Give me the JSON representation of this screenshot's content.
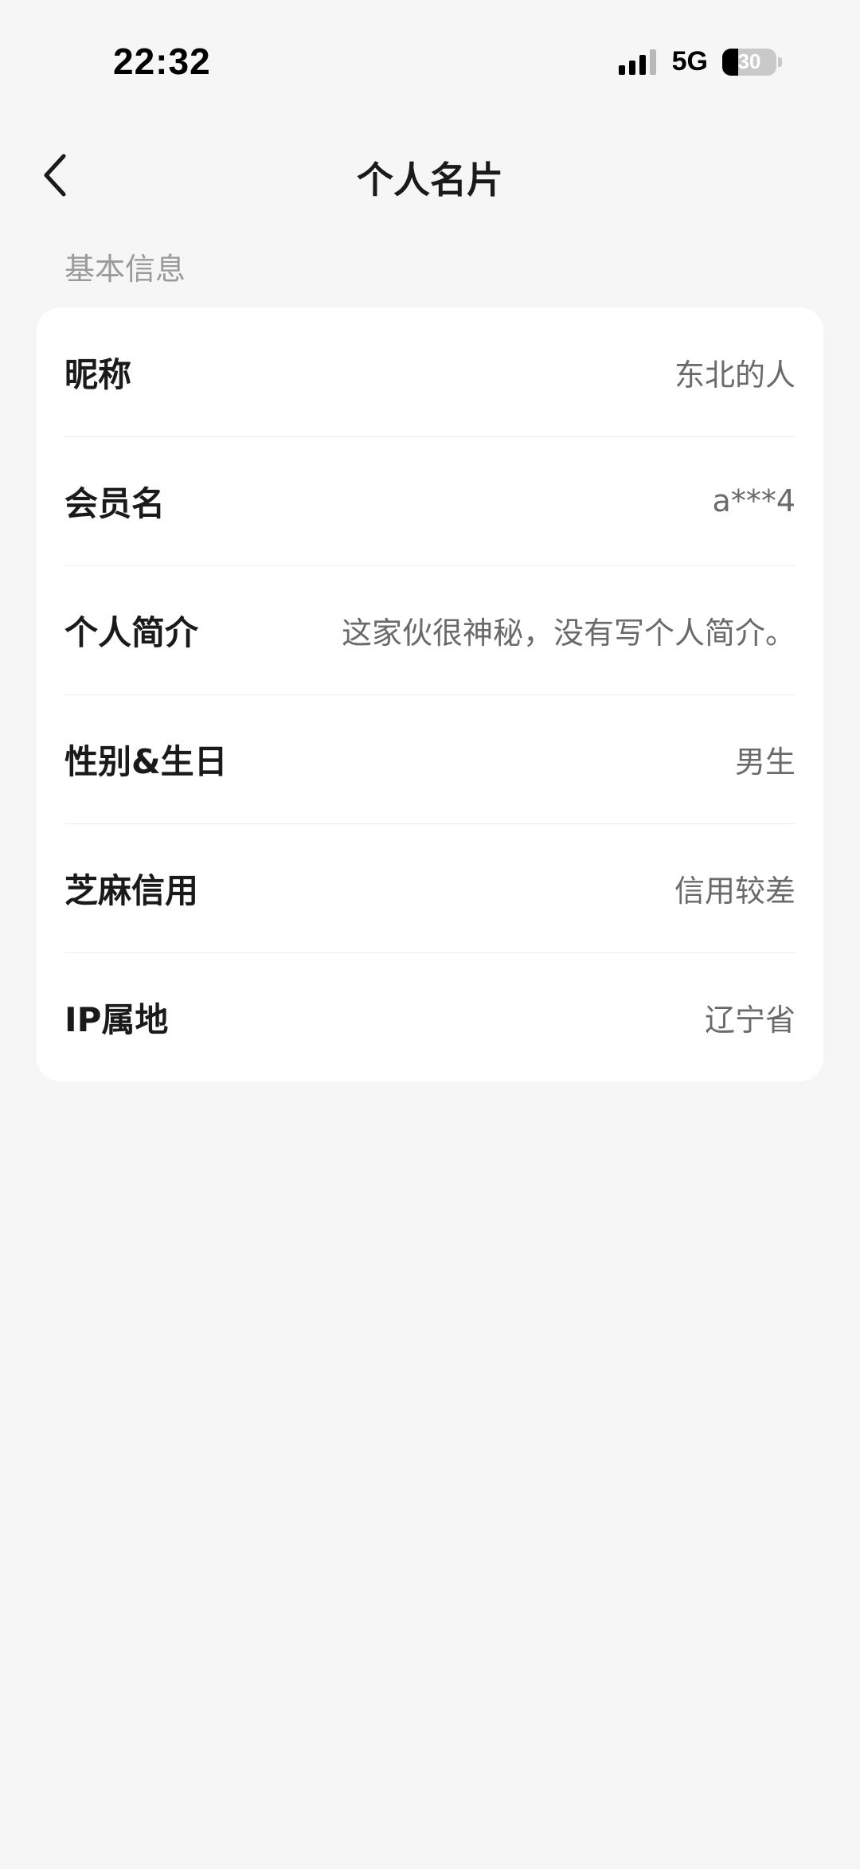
{
  "status_bar": {
    "time": "22:32",
    "network": "5G",
    "battery": "30",
    "battery_level": 0.3
  },
  "nav": {
    "title": "个人名片",
    "back_icon": "chevron-left-icon"
  },
  "section": {
    "title": "基本信息"
  },
  "rows": [
    {
      "label": "昵称",
      "value": "东北的人"
    },
    {
      "label": "会员名",
      "value": "a***4"
    },
    {
      "label": "个人简介",
      "value": "这家伙很神秘，没有写个人简介。"
    },
    {
      "label": "性别&生日",
      "value": "男生"
    },
    {
      "label": "芝麻信用",
      "value": "信用较差"
    },
    {
      "label": "IP属地",
      "value": "辽宁省"
    }
  ],
  "colors": {
    "background": "#f6f6f6",
    "card": "#ffffff",
    "label": "#1a1a1a",
    "value": "#6a6a6a",
    "section_header": "#9a9a9a"
  }
}
